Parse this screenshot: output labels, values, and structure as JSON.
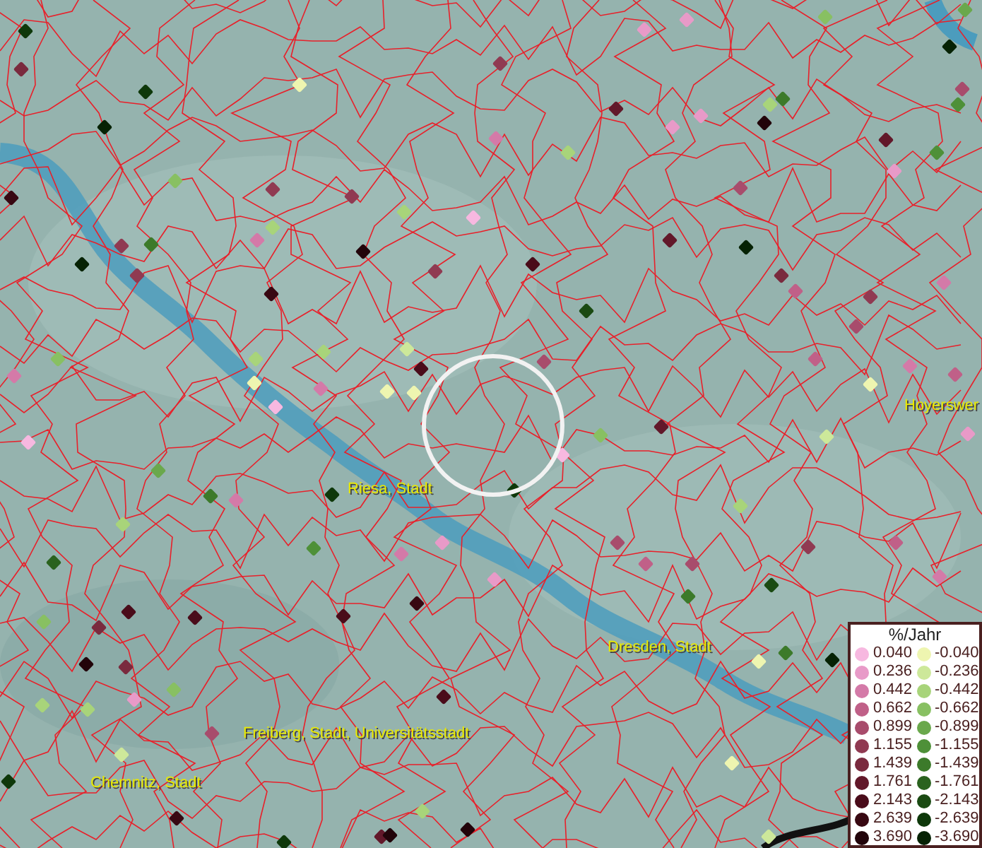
{
  "places": [
    {
      "name": "Hoyerswer"
    },
    {
      "name": "Riesa, Stadt"
    },
    {
      "name": "Dresden, Stadt"
    },
    {
      "name": "Freiberg, Stadt, Universitätsstadt"
    },
    {
      "name": "Chemnitz, Stadt"
    }
  ],
  "legend": {
    "title": "%/Jahr",
    "rows": [
      {
        "value": "0.040",
        "color": "#f7b8e0"
      },
      {
        "value": "-0.040",
        "color": "#eef5b0"
      },
      {
        "value": "0.236",
        "color": "#e89ac8"
      },
      {
        "value": "-0.236",
        "color": "#cde89a"
      },
      {
        "value": "0.442",
        "color": "#d47aa8"
      },
      {
        "value": "-0.442",
        "color": "#a8d47a"
      },
      {
        "value": "0.662",
        "color": "#c06088"
      },
      {
        "value": "-0.662",
        "color": "#88c062"
      },
      {
        "value": "0.899",
        "color": "#a84c6c"
      },
      {
        "value": "-0.899",
        "color": "#6aa84c"
      },
      {
        "value": "1.155",
        "color": "#903a52"
      },
      {
        "value": "-1.155",
        "color": "#4e9038"
      },
      {
        "value": "1.439",
        "color": "#7a2a3e"
      },
      {
        "value": "-1.439",
        "color": "#3c7a2a"
      },
      {
        "value": "1.761",
        "color": "#62182a"
      },
      {
        "value": "-1.761",
        "color": "#2a621e"
      },
      {
        "value": "2.143",
        "color": "#4a0c1a"
      },
      {
        "value": "-2.143",
        "color": "#1a4a12"
      },
      {
        "value": "2.639",
        "color": "#380812"
      },
      {
        "value": "-2.639",
        "color": "#0e380a"
      },
      {
        "value": "3.690",
        "color": "#22040a"
      },
      {
        "value": "-3.690",
        "color": "#062204"
      }
    ]
  }
}
